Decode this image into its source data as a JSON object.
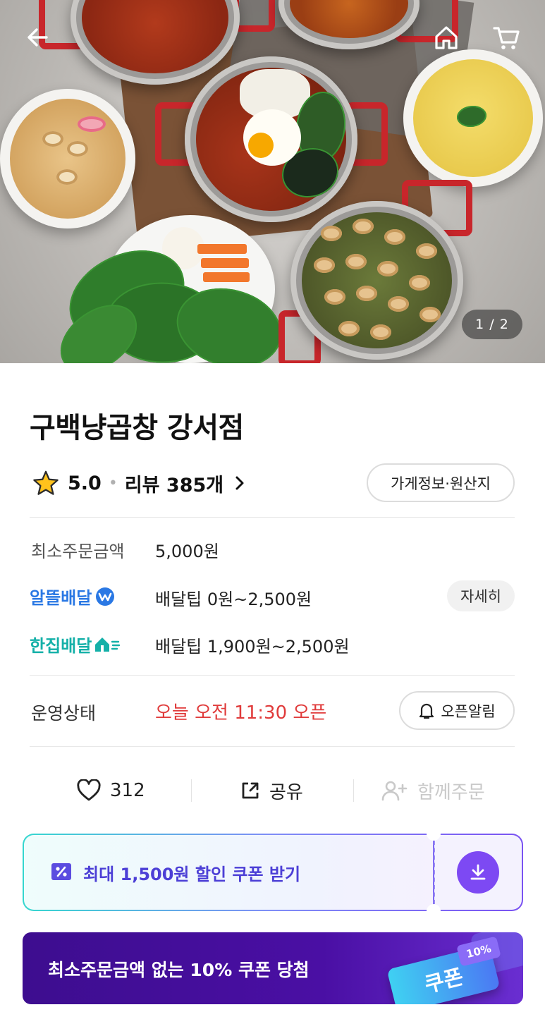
{
  "hero": {
    "page_indicator": "1 / 2",
    "nav_icons": [
      "back-arrow-icon",
      "home-icon",
      "cart-icon"
    ]
  },
  "store": {
    "name": "구백냥곱창 강서점",
    "rating": "5.0",
    "review_label": "리뷰 385개",
    "info_button": "가게정보·원산지"
  },
  "order_info": {
    "min_order_label": "최소주문금액",
    "min_order_value": "5,000원",
    "delivery_options": [
      {
        "brand": "알뜰배달",
        "fee": "배달팁 0원~2,500원",
        "action": "자세히",
        "color": "#2a78e4"
      },
      {
        "brand": "한집배달",
        "fee": "배달팁 1,900원~2,500원",
        "color": "#14b0a8"
      }
    ]
  },
  "status": {
    "label": "운영상태",
    "value": "오늘 오전 11:30 오픈",
    "alarm_button": "오픈알림"
  },
  "actions": {
    "like_count": "312",
    "share_label": "공유",
    "group_order_label": "함께주문"
  },
  "coupon": {
    "text": "최대 1,500원 할인 쿠폰 받기"
  },
  "banner": {
    "text": "최소주문금액 없는 10% 쿠폰 당첨",
    "ticket_label": "쿠폰",
    "ticket_tag": "10%"
  },
  "colors": {
    "accent_purple": "#7d49f3",
    "status_red": "#e03b3b",
    "banner_purple": "#4a0fa4"
  }
}
